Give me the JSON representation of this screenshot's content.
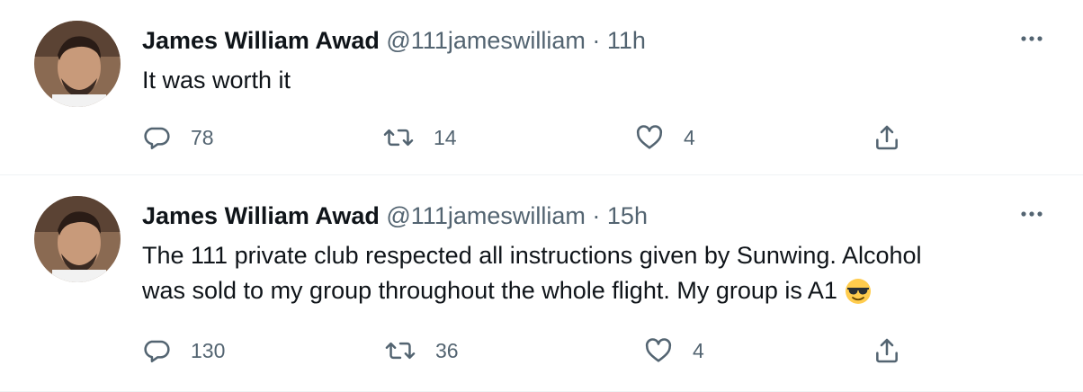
{
  "tweets": [
    {
      "author_name": "James William Awad",
      "handle": "@111jameswilliam",
      "separator": "·",
      "time": "11h",
      "text_lines": [
        "It was worth it"
      ],
      "replies": "78",
      "retweets": "14",
      "likes": "4",
      "emoji": ""
    },
    {
      "author_name": "James William Awad",
      "handle": "@111jameswilliam",
      "separator": "·",
      "time": "15h",
      "text_lines": [
        "The 111 private club respected all instructions given by Sunwing. Alcohol",
        "was sold to my group throughout the whole flight. My group is A1"
      ],
      "replies": "130",
      "retweets": "36",
      "likes": "4",
      "emoji": "smiling-face-with-sunglasses"
    }
  ],
  "icons": {
    "more": "more-horizontal-icon",
    "reply": "reply-bubble-icon",
    "retweet": "retweet-icon",
    "like": "heart-icon",
    "share": "share-icon"
  },
  "colors": {
    "text": "#0f1419",
    "secondary": "#536471",
    "divider": "#eff3f4"
  }
}
